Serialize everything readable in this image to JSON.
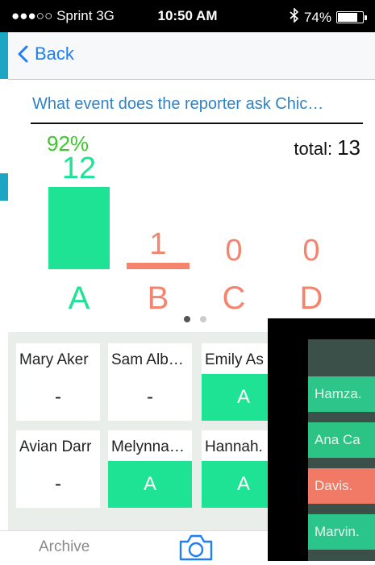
{
  "status": {
    "carrier": "●●●○○ Sprint  3G",
    "time": "10:50 AM",
    "bluetooth": "∗",
    "battery": "74%"
  },
  "nav": {
    "back_label": "Back"
  },
  "question": "What event does the reporter ask Chic…",
  "stats": {
    "percent": "92%",
    "total_label": "total:",
    "total": "13"
  },
  "chart_data": {
    "type": "bar",
    "categories": [
      "A",
      "B",
      "C",
      "D"
    ],
    "values": [
      12,
      1,
      0,
      0
    ],
    "labels": [
      "12",
      "1",
      "0",
      "0"
    ],
    "colors": [
      "#1ee395",
      "#f5846f",
      "#f5846f",
      "#f5846f"
    ]
  },
  "students": [
    {
      "name": "Mary Aker",
      "answer": "-"
    },
    {
      "name": "Sam Alb…",
      "answer": "-"
    },
    {
      "name": "Emily As",
      "answer": "A"
    },
    {
      "name": "Avian Darr",
      "answer": "-"
    },
    {
      "name": "Melynna…",
      "answer": "A"
    },
    {
      "name": "Hannah.",
      "answer": "A"
    }
  ],
  "preview_rows": [
    "Hamza.",
    "Ana Ca",
    "Davis.",
    "Marvin."
  ],
  "tabs": {
    "archive": "Archive"
  },
  "colors": {
    "accent": "#1e7ef5",
    "correct": "#1ee395",
    "wrong": "#f5846f",
    "percent": "#3cc82a",
    "question": "#2f82c6"
  }
}
